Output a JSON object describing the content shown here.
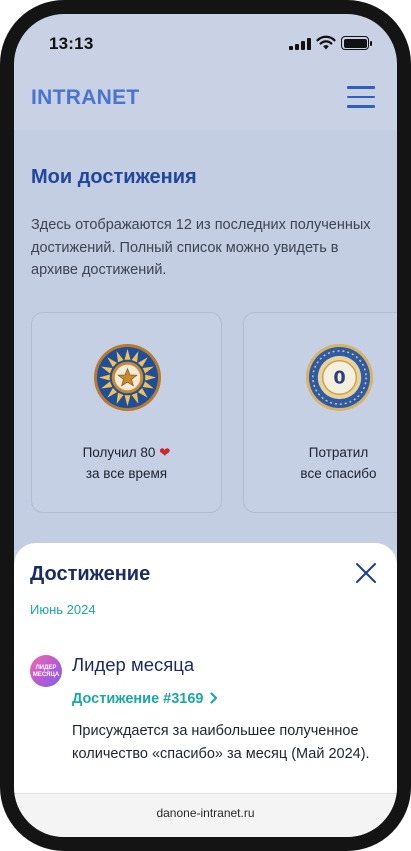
{
  "status_bar": {
    "time": "13:13"
  },
  "header": {
    "logo": "INTRANET",
    "menu_icon": "hamburger-menu-icon"
  },
  "main": {
    "title": "Мои достижения",
    "description": "Здесь отображаются 12 из последних полученных достижений. Полный список можно увидеть в архиве достижений.",
    "cards": [
      {
        "line1": "Получил 80",
        "heart": "❤",
        "line2": "за все время",
        "icon": "sun-star-medal-icon"
      },
      {
        "line1": "Потратил",
        "line2": "все спасибо",
        "icon": "zero-coin-medal-icon",
        "badge_text": "0"
      }
    ],
    "pagination": {
      "count": 12,
      "active_index": 0
    }
  },
  "sheet": {
    "title": "Достижение",
    "date": "Июнь 2024",
    "achievement": {
      "name": "Лидер месяца",
      "avatar_text": "ЛИДЕР МЕСЯЦА",
      "link": "Достижение #3169",
      "description": "Присуждается за наибольшее полученное количество «спасибо» за месяц (Май 2024)."
    }
  },
  "browser": {
    "url": "danone-intranet.ru"
  },
  "colors": {
    "brand_blue": "#4a74cf",
    "title_blue": "#21479c",
    "accent_teal": "#18a9a0",
    "sheet_heading": "#1a2b66"
  }
}
